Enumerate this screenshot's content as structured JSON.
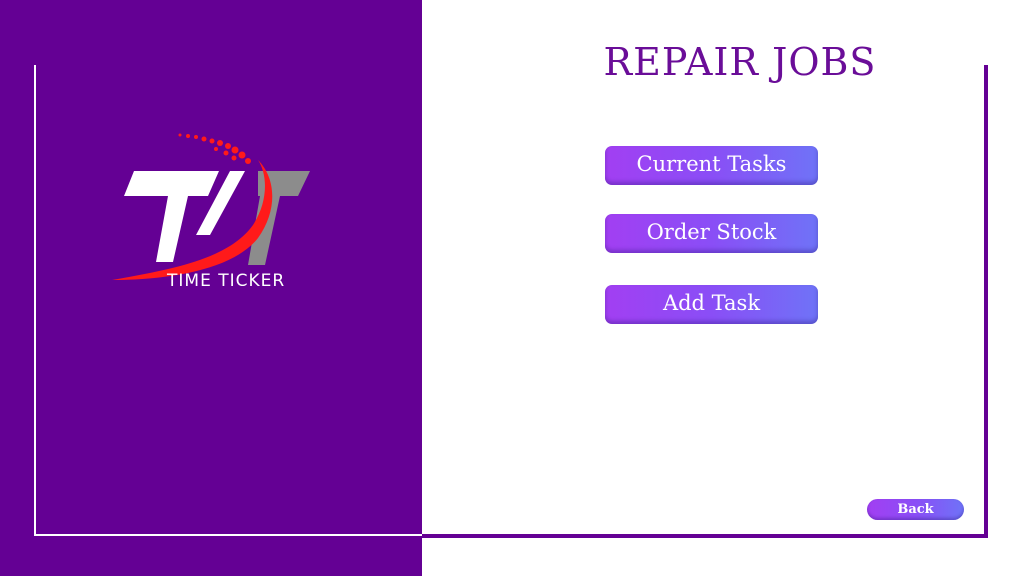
{
  "logo": {
    "brand_name": "TIME TICKER",
    "monogram": "TT"
  },
  "header": {
    "title": "REPAIR JOBS"
  },
  "menu": {
    "current_tasks_label": "Current Tasks",
    "order_stock_label": "Order Stock",
    "add_task_label": "Add Task"
  },
  "footer": {
    "back_label": "Back"
  },
  "colors": {
    "panel_purple": "#640094",
    "title_purple": "#6a0d98",
    "button_gradient_start": "#a23ff2",
    "button_gradient_end": "#6f73f7",
    "logo_red": "#ff1a1a",
    "logo_gray": "#8c8c8c"
  }
}
